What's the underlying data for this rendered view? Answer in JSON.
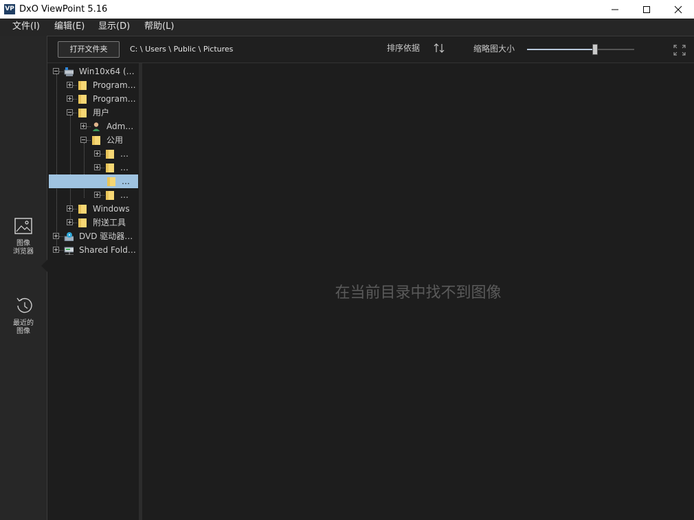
{
  "window": {
    "app_icon_text": "VP",
    "title": "DxO ViewPoint 5.16"
  },
  "menu": [
    "文件(I)",
    "编辑(E)",
    "显示(D)",
    "帮助(L)"
  ],
  "sidebar": {
    "items": [
      {
        "label": "图像\n浏览器",
        "icon": "image-icon",
        "active": true
      },
      {
        "label": "最近的\n图像",
        "icon": "history-clock-icon",
        "active": false
      }
    ]
  },
  "toolbar": {
    "open_folder": "打开文件夹",
    "path": "C: \\ Users \\ Public \\ Pictures",
    "sort_label": "排序依据",
    "sort_icon": "sort-arrows-icon",
    "thumb_label": "缩略图大小",
    "thumb_size_fraction": 0.63
  },
  "tree": [
    {
      "label": "Win10x64 (…",
      "icon": "computer-icon",
      "level": 0,
      "expander": "minus"
    },
    {
      "label": "Program…",
      "icon": "folder-icon",
      "level": 1,
      "expander": "plus"
    },
    {
      "label": "Program…",
      "icon": "folder-icon",
      "level": 1,
      "expander": "plus"
    },
    {
      "label": "用户",
      "icon": "folder-icon",
      "level": 1,
      "expander": "minus"
    },
    {
      "label": "Adm…",
      "icon": "user-icon",
      "level": 2,
      "expander": "plus"
    },
    {
      "label": "公用",
      "icon": "folder-icon",
      "level": 2,
      "expander": "minus"
    },
    {
      "label": "…",
      "icon": "folder-icon",
      "level": 3,
      "expander": "plus"
    },
    {
      "label": "…",
      "icon": "folder-icon",
      "level": 3,
      "expander": "plus"
    },
    {
      "label": "…",
      "icon": "folder-icon",
      "level": 3,
      "expander": "none",
      "selected": true
    },
    {
      "label": "…",
      "icon": "folder-icon",
      "level": 3,
      "expander": "plus"
    },
    {
      "label": "Windows",
      "icon": "folder-icon",
      "level": 1,
      "expander": "plus"
    },
    {
      "label": "附送工具",
      "icon": "folder-icon",
      "level": 1,
      "expander": "plus"
    },
    {
      "label": "DVD 驱动器…",
      "icon": "dvd-drive-icon",
      "level": 0,
      "expander": "plus"
    },
    {
      "label": "Shared Fold…",
      "icon": "network-drive-icon",
      "level": 0,
      "expander": "plus"
    }
  ],
  "content": {
    "empty_message": "在当前目录中找不到图像"
  }
}
